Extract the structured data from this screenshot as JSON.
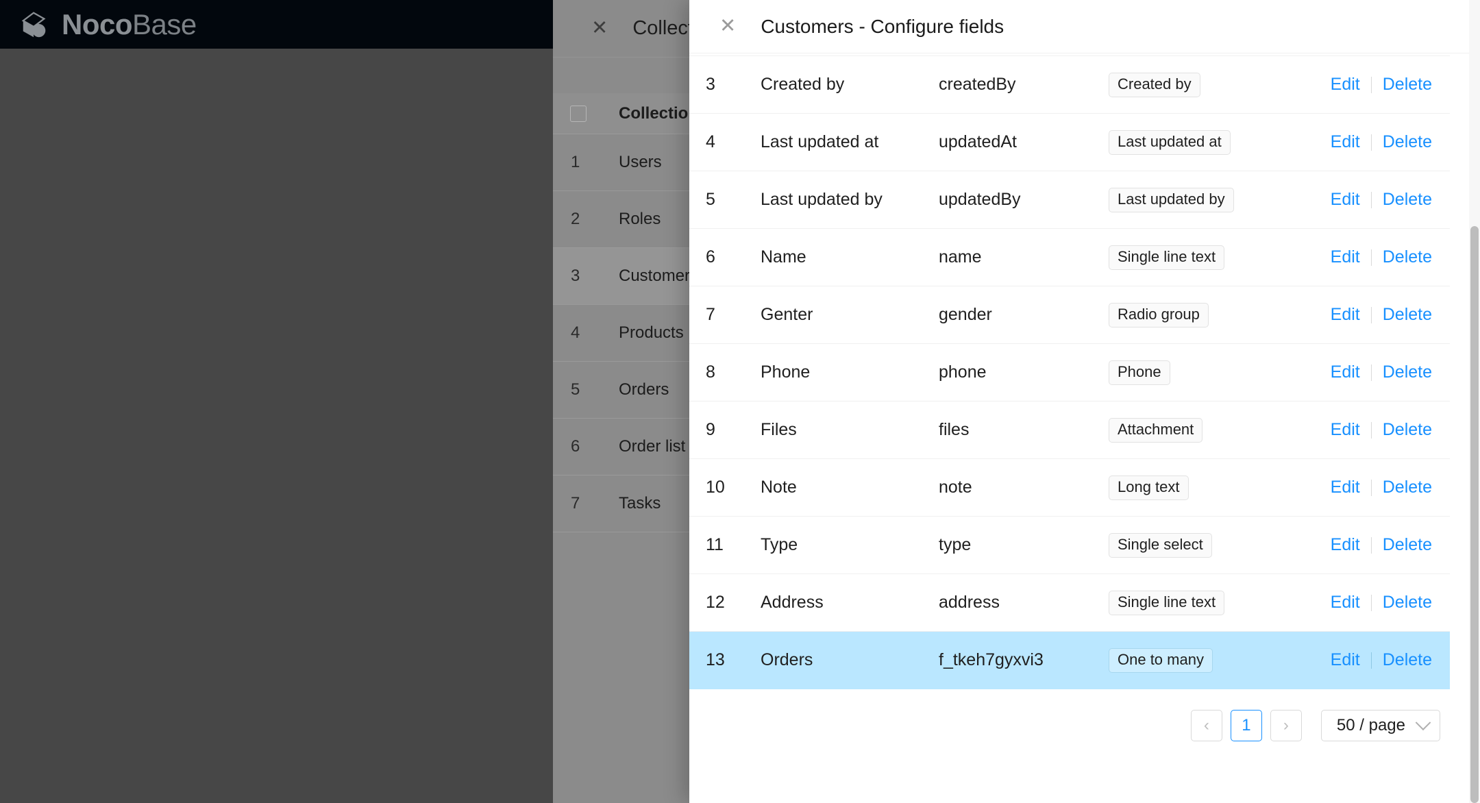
{
  "app": {
    "brand_primary": "Noco",
    "brand_secondary": "Base",
    "logo_icon": "nocobase-cube-logo"
  },
  "colors": {
    "link": "#1890ff",
    "row_highlight": "#bae7ff",
    "topbar": "#02070d",
    "app_background": "#474747",
    "drawer_mask": "#8b8b8b"
  },
  "background_drawer": {
    "close_icon_label": "✕",
    "title": "Collections & Fie",
    "table": {
      "header": {
        "checkbox": "",
        "display_name": "Collection dis"
      },
      "rows": [
        {
          "index": "1",
          "name": "Users"
        },
        {
          "index": "2",
          "name": "Roles"
        },
        {
          "index": "3",
          "name": "Customers",
          "selected": true
        },
        {
          "index": "4",
          "name": "Products"
        },
        {
          "index": "5",
          "name": "Orders"
        },
        {
          "index": "6",
          "name": "Order list"
        },
        {
          "index": "7",
          "name": "Tasks"
        }
      ]
    }
  },
  "front_drawer": {
    "close_icon_label": "✕",
    "title": "Customers - Configure fields",
    "actions": {
      "edit": "Edit",
      "delete": "Delete"
    },
    "rows": [
      {
        "index": "3",
        "title": "Created by",
        "name": "createdBy",
        "interface": "Created by"
      },
      {
        "index": "4",
        "title": "Last updated at",
        "name": "updatedAt",
        "interface": "Last updated at"
      },
      {
        "index": "5",
        "title": "Last updated by",
        "name": "updatedBy",
        "interface": "Last updated by"
      },
      {
        "index": "6",
        "title": "Name",
        "name": "name",
        "interface": "Single line text"
      },
      {
        "index": "7",
        "title": "Genter",
        "name": "gender",
        "interface": "Radio group"
      },
      {
        "index": "8",
        "title": "Phone",
        "name": "phone",
        "interface": "Phone"
      },
      {
        "index": "9",
        "title": "Files",
        "name": "files",
        "interface": "Attachment"
      },
      {
        "index": "10",
        "title": "Note",
        "name": "note",
        "interface": "Long text"
      },
      {
        "index": "11",
        "title": "Type",
        "name": "type",
        "interface": "Single select"
      },
      {
        "index": "12",
        "title": "Address",
        "name": "address",
        "interface": "Single line text"
      },
      {
        "index": "13",
        "title": "Orders",
        "name": "f_tkeh7gyxvi3",
        "interface": "One to many",
        "highlight": true
      }
    ],
    "pagination": {
      "prev_icon": "‹",
      "next_icon": "›",
      "current_page": "1",
      "page_size": "50 / page",
      "chevron_icon": "chevron-down-icon"
    }
  }
}
